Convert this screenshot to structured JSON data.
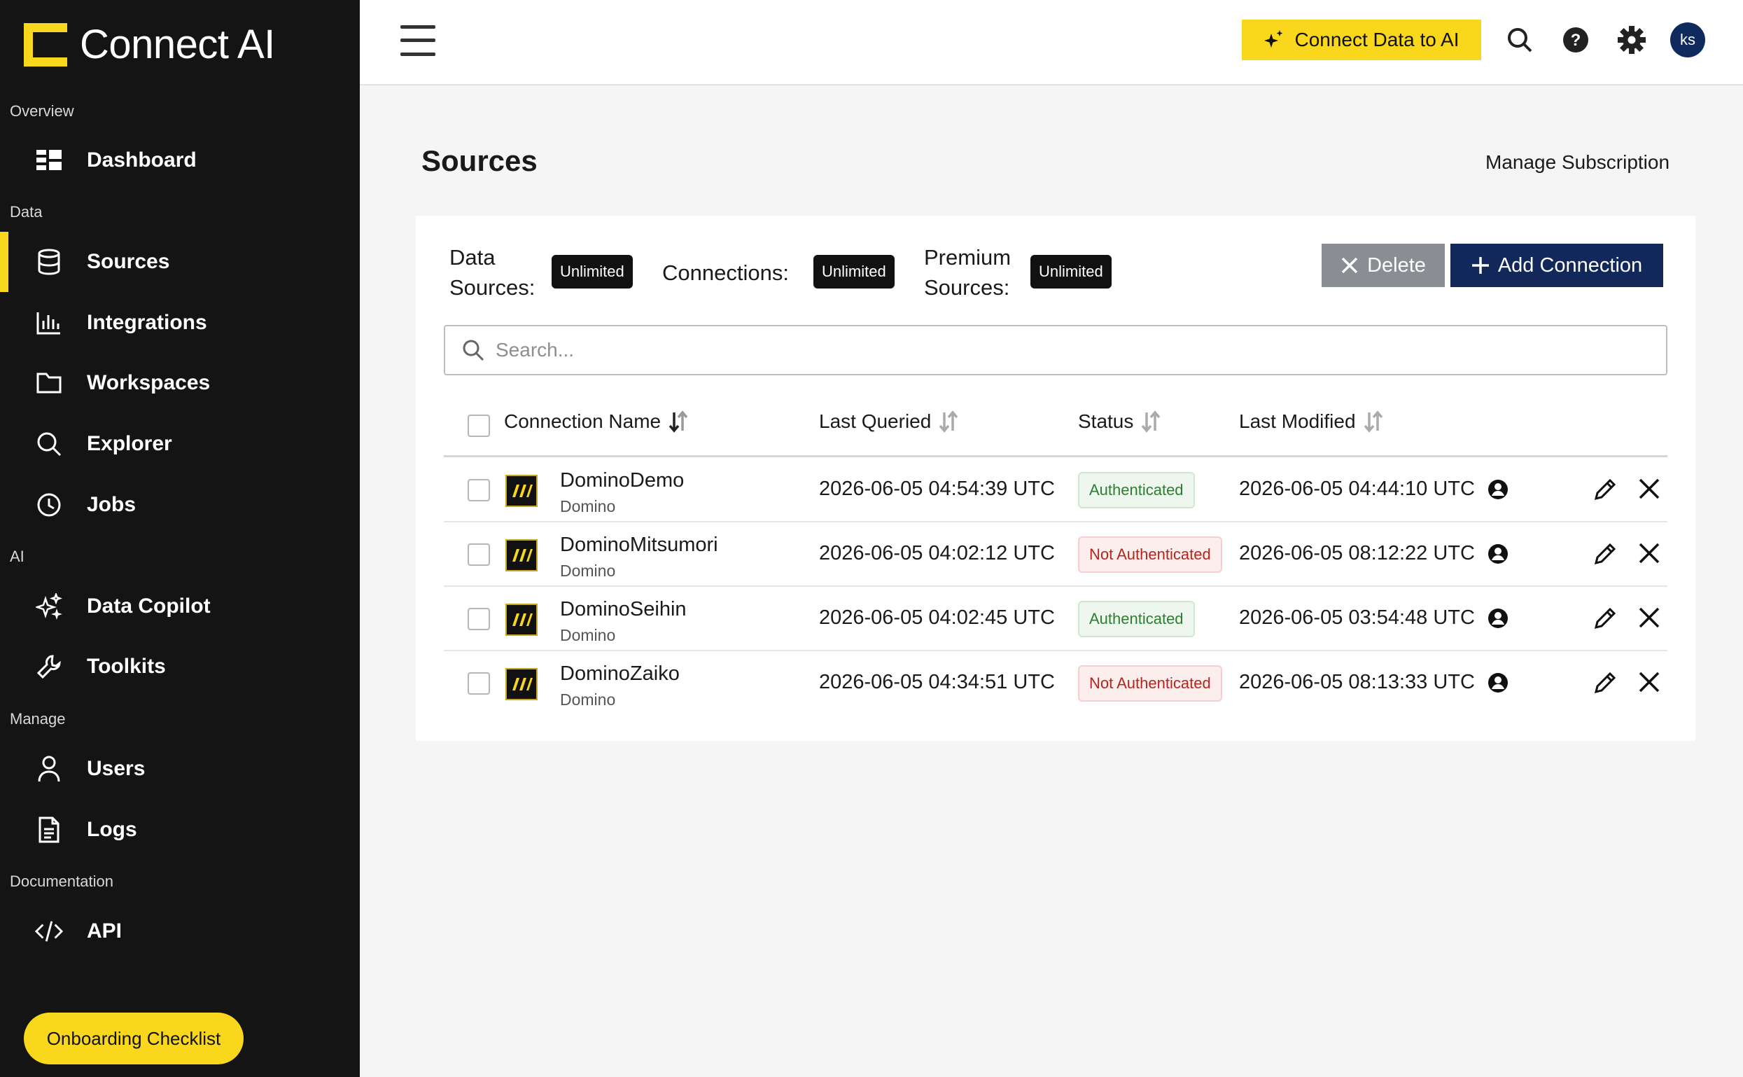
{
  "brand": {
    "name": "Connect AI",
    "accent": "#f9d71c"
  },
  "sidebar": {
    "sections": [
      {
        "label": "Overview",
        "items": [
          {
            "label": "Dashboard",
            "icon": "dashboard-icon"
          }
        ]
      },
      {
        "label": "Data",
        "items": [
          {
            "label": "Sources",
            "icon": "database-icon",
            "active": true
          },
          {
            "label": "Integrations",
            "icon": "chart-icon"
          },
          {
            "label": "Workspaces",
            "icon": "folder-icon"
          },
          {
            "label": "Explorer",
            "icon": "search-icon"
          },
          {
            "label": "Jobs",
            "icon": "clock-icon"
          }
        ]
      },
      {
        "label": "AI",
        "items": [
          {
            "label": "Data Copilot",
            "icon": "sparkle-icon"
          },
          {
            "label": "Toolkits",
            "icon": "wrench-icon"
          }
        ]
      },
      {
        "label": "Manage",
        "items": [
          {
            "label": "Users",
            "icon": "user-icon"
          },
          {
            "label": "Logs",
            "icon": "document-icon"
          }
        ]
      },
      {
        "label": "Documentation",
        "items": [
          {
            "label": "API",
            "icon": "code-icon"
          }
        ]
      }
    ],
    "onboarding": "Onboarding Checklist"
  },
  "header": {
    "cta": "Connect Data to AI",
    "avatar": "ks"
  },
  "main": {
    "title": "Sources",
    "manage_subscription": "Manage Subscription",
    "quotas": [
      {
        "label_line1": "Data",
        "label_line2": "Sources:",
        "value": "Unlimited"
      },
      {
        "label": "Connections:",
        "value": "Unlimited"
      },
      {
        "label_line1": "Premium",
        "label_line2": "Sources:",
        "value": "Unlimited"
      }
    ],
    "delete_label": "Delete",
    "add_label": "Add Connection",
    "search_placeholder": "Search...",
    "columns": [
      "Connection Name",
      "Last Queried",
      "Status",
      "Last Modified"
    ],
    "rows": [
      {
        "name": "DominoDemo",
        "type": "Domino",
        "last_queried": "2026-06-05 04:54:39 UTC",
        "status": "Authenticated",
        "last_modified": "2026-06-05 04:44:10 UTC"
      },
      {
        "name": "DominoMitsumori",
        "type": "Domino",
        "last_queried": "2026-06-05 04:02:12 UTC",
        "status": "Not Authenticated",
        "last_modified": "2026-06-05 08:12:22 UTC"
      },
      {
        "name": "DominoSeihin",
        "type": "Domino",
        "last_queried": "2026-06-05 04:02:45 UTC",
        "status": "Authenticated",
        "last_modified": "2026-06-05 03:54:48 UTC"
      },
      {
        "name": "DominoZaiko",
        "type": "Domino",
        "last_queried": "2026-06-05 04:34:51 UTC",
        "status": "Not Authenticated",
        "last_modified": "2026-06-05 08:13:33 UTC"
      }
    ]
  }
}
